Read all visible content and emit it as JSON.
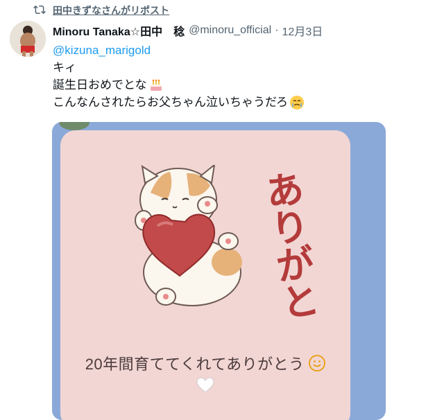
{
  "repost": {
    "icon": "repost-icon",
    "text": "田中きずなさんがリポスト"
  },
  "tweet": {
    "display_name": "Minoru Tanaka☆田中　稔",
    "handle": "@minoru_official",
    "separator": "·",
    "time": "12月3日",
    "mention": "@kizuna_marigold",
    "lines": [
      "キィ",
      "誕生日おめでとな",
      "こんなんされたらお父ちゃん泣いちゃうだろ"
    ],
    "line_emojis": [
      "",
      "cake-emoji",
      "crying-face-emoji"
    ]
  },
  "media": {
    "sticker_text": "ありがと",
    "message": "20年間育ててくれてありがとう",
    "message_emoji": "smile-emoji",
    "heart_emoji": "white-heart-emoji",
    "colors": {
      "frame": "#8ba9d8",
      "card": "#f2d6d4",
      "sticker_text": "#b43b3b"
    }
  }
}
